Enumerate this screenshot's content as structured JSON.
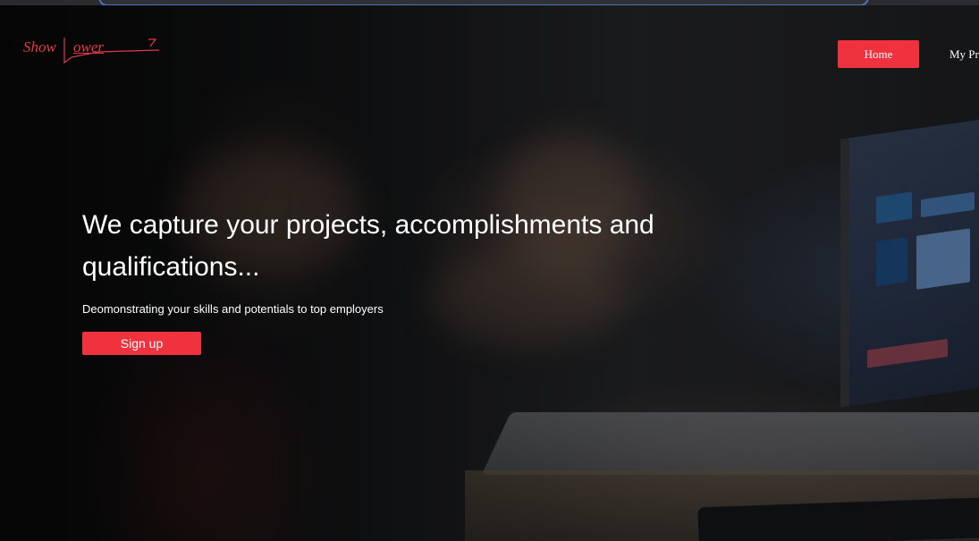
{
  "header": {
    "logo": {
      "text_part1": "Show",
      "text_part2": "ower",
      "icon": "pen-stroke-icon",
      "color": "#e23a48"
    },
    "nav": {
      "items": [
        {
          "label": "Home",
          "active": true
        },
        {
          "label": "My Pr"
        }
      ]
    }
  },
  "hero": {
    "background_image": "blurred-office-laptop-hands-photo",
    "headline": "We capture your projects, accomplishments and qualifications...",
    "subheadline": "Deomonstrating your skills and potentials to top employers",
    "cta_label": "Sign up"
  },
  "colors": {
    "accent": "#f0323e",
    "text": "#ffffff",
    "background": "#0d0d0e"
  }
}
